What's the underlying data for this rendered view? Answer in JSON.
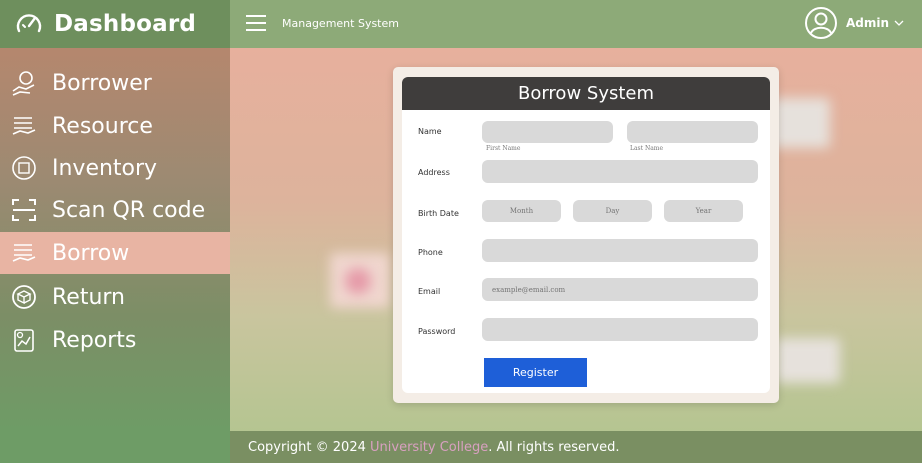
{
  "header": {
    "brand_title": "Dashboard",
    "system_title": "Management System",
    "user_name": "Admin"
  },
  "sidebar": {
    "items": [
      {
        "label": "Borrower",
        "icon": "hand-coin-icon"
      },
      {
        "label": "Resource",
        "icon": "hand-stack-icon"
      },
      {
        "label": "Inventory",
        "icon": "inventory-icon"
      },
      {
        "label": "Scan QR code",
        "icon": "scan-icon"
      },
      {
        "label": "Borrow",
        "icon": "hand-stack-icon",
        "active": true
      },
      {
        "label": "Return",
        "icon": "return-box-icon"
      },
      {
        "label": "Reports",
        "icon": "report-icon"
      }
    ]
  },
  "form": {
    "title": "Borrow System",
    "labels": {
      "name": "Name",
      "address": "Address",
      "birth_date": "Birth Date",
      "phone": "Phone",
      "email": "Email",
      "password": "Password"
    },
    "first_name_caption": "First Name",
    "last_name_caption": "Last Name",
    "month_placeholder": "Month",
    "day_placeholder": "Day",
    "year_placeholder": "Year",
    "email_placeholder": "example@email.com",
    "register_label": "Register"
  },
  "footer": {
    "prefix": "Copyright © 2024 ",
    "college": "University College",
    "suffix": ". All rights reserved."
  },
  "colors": {
    "topbar": "#8daa78",
    "active_item": "#e8b4a3",
    "register_button": "#1e5fd8",
    "card_header": "#3f3d3c"
  }
}
